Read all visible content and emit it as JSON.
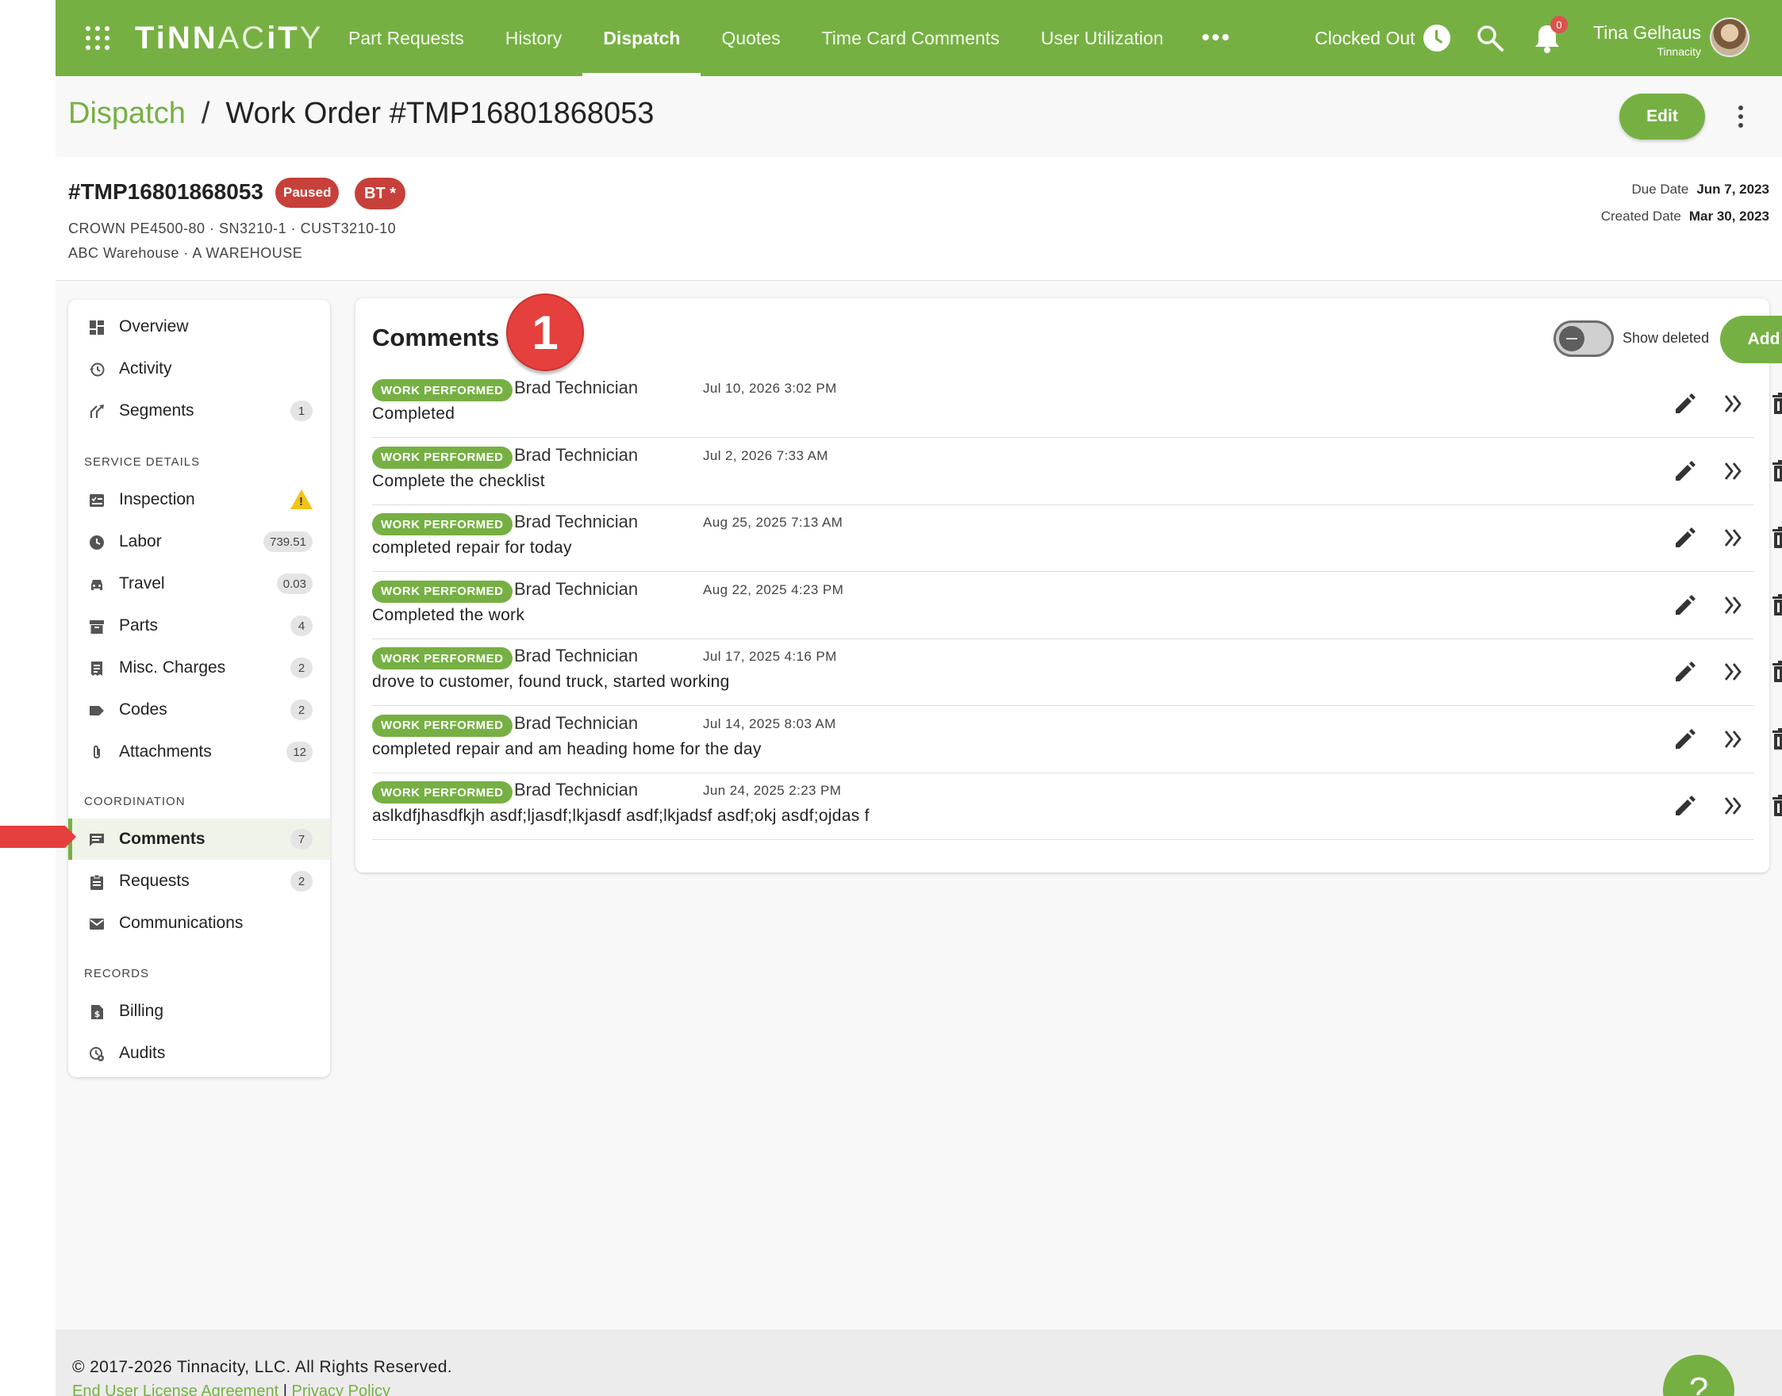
{
  "app": {
    "logo": {
      "bold": "TiNN",
      "thin": "AC",
      "bold2": "iT",
      "thin2": "Y"
    },
    "nav": [
      "Part Requests",
      "History",
      "Dispatch",
      "Quotes",
      "Time Card Comments",
      "User Utilization"
    ],
    "nav_active": "Dispatch",
    "more": "•••",
    "clock_status": "Clocked Out",
    "notifications": "0",
    "user": {
      "name": "Tina Gelhaus",
      "org": "Tinnacity"
    },
    "accent": "#76b043",
    "alert_color": "#c8403a"
  },
  "header": {
    "breadcrumb_root": "Dispatch",
    "separator": "/",
    "title": "Work Order #TMP16801868053",
    "edit_label": "Edit"
  },
  "work_order": {
    "number": "#TMP16801868053",
    "status": "Paused",
    "tech_badge": "BT *",
    "equipment": "CROWN PE4500-80 · SN3210-1 · CUST3210-10",
    "location": "ABC Warehouse · A WAREHOUSE",
    "due_label": "Due Date",
    "due_date": "Jun 7, 2023",
    "created_label": "Created Date",
    "created_date": "Mar 30, 2023"
  },
  "sidenav": {
    "top": [
      {
        "label": "Overview",
        "icon": "dashboard-icon"
      },
      {
        "label": "Activity",
        "icon": "history-icon"
      },
      {
        "label": "Segments",
        "icon": "segments-icon",
        "count": "1"
      }
    ],
    "service_title": "SERVICE DETAILS",
    "service": [
      {
        "label": "Inspection",
        "icon": "checklist-icon",
        "warning": true
      },
      {
        "label": "Labor",
        "icon": "clock-icon",
        "count": "739.51"
      },
      {
        "label": "Travel",
        "icon": "car-icon",
        "count": "0.03"
      },
      {
        "label": "Parts",
        "icon": "archive-icon",
        "count": "4"
      },
      {
        "label": "Misc. Charges",
        "icon": "receipt-icon",
        "count": "2"
      },
      {
        "label": "Codes",
        "icon": "label-icon",
        "count": "2"
      },
      {
        "label": "Attachments",
        "icon": "paperclip-icon",
        "count": "12"
      }
    ],
    "coordination_title": "COORDINATION",
    "coordination": [
      {
        "label": "Comments",
        "icon": "comment-icon",
        "count": "7",
        "active": true
      },
      {
        "label": "Requests",
        "icon": "clipboard-icon",
        "count": "2"
      },
      {
        "label": "Communications",
        "icon": "mail-icon"
      }
    ],
    "records_title": "RECORDS",
    "records": [
      {
        "label": "Billing",
        "icon": "billing-icon"
      },
      {
        "label": "Audits",
        "icon": "audit-icon"
      }
    ]
  },
  "comments": {
    "title": "Comments",
    "step_number": "1",
    "show_deleted_label": "Show deleted",
    "show_deleted": false,
    "add_label": "Add",
    "items": [
      {
        "type": "WORK PERFORMED",
        "author": "Brad Technician",
        "time": "Jul 10, 2026 3:02 PM",
        "text": "Completed"
      },
      {
        "type": "WORK PERFORMED",
        "author": "Brad Technician",
        "time": "Jul 2, 2026 7:33 AM",
        "text": "Complete the checklist"
      },
      {
        "type": "WORK PERFORMED",
        "author": "Brad Technician",
        "time": "Aug 25, 2025 7:13 AM",
        "text": "completed repair for today"
      },
      {
        "type": "WORK PERFORMED",
        "author": "Brad Technician",
        "time": "Aug 22, 2025 4:23 PM",
        "text": "Completed the work"
      },
      {
        "type": "WORK PERFORMED",
        "author": "Brad Technician",
        "time": "Jul 17, 2025 4:16 PM",
        "text": "drove to customer, found truck, started working"
      },
      {
        "type": "WORK PERFORMED",
        "author": "Brad Technician",
        "time": "Jul 14, 2025 8:03 AM",
        "text": "completed repair and am heading home for the day"
      },
      {
        "type": "WORK PERFORMED",
        "author": "Brad Technician",
        "time": "Jun 24, 2025 2:23 PM",
        "text": "aslkdfjhasdfkjh asdf;ljasdf;lkjasdf asdf;lkjadsf asdf;okj asdf;ojdas f"
      }
    ]
  },
  "footer": {
    "copyright": "© 2017-2026 Tinnacity, LLC. All Rights Reserved.",
    "eula": "End User License Agreement",
    "divider": "|",
    "privacy": "Privacy Policy",
    "help": "?"
  }
}
